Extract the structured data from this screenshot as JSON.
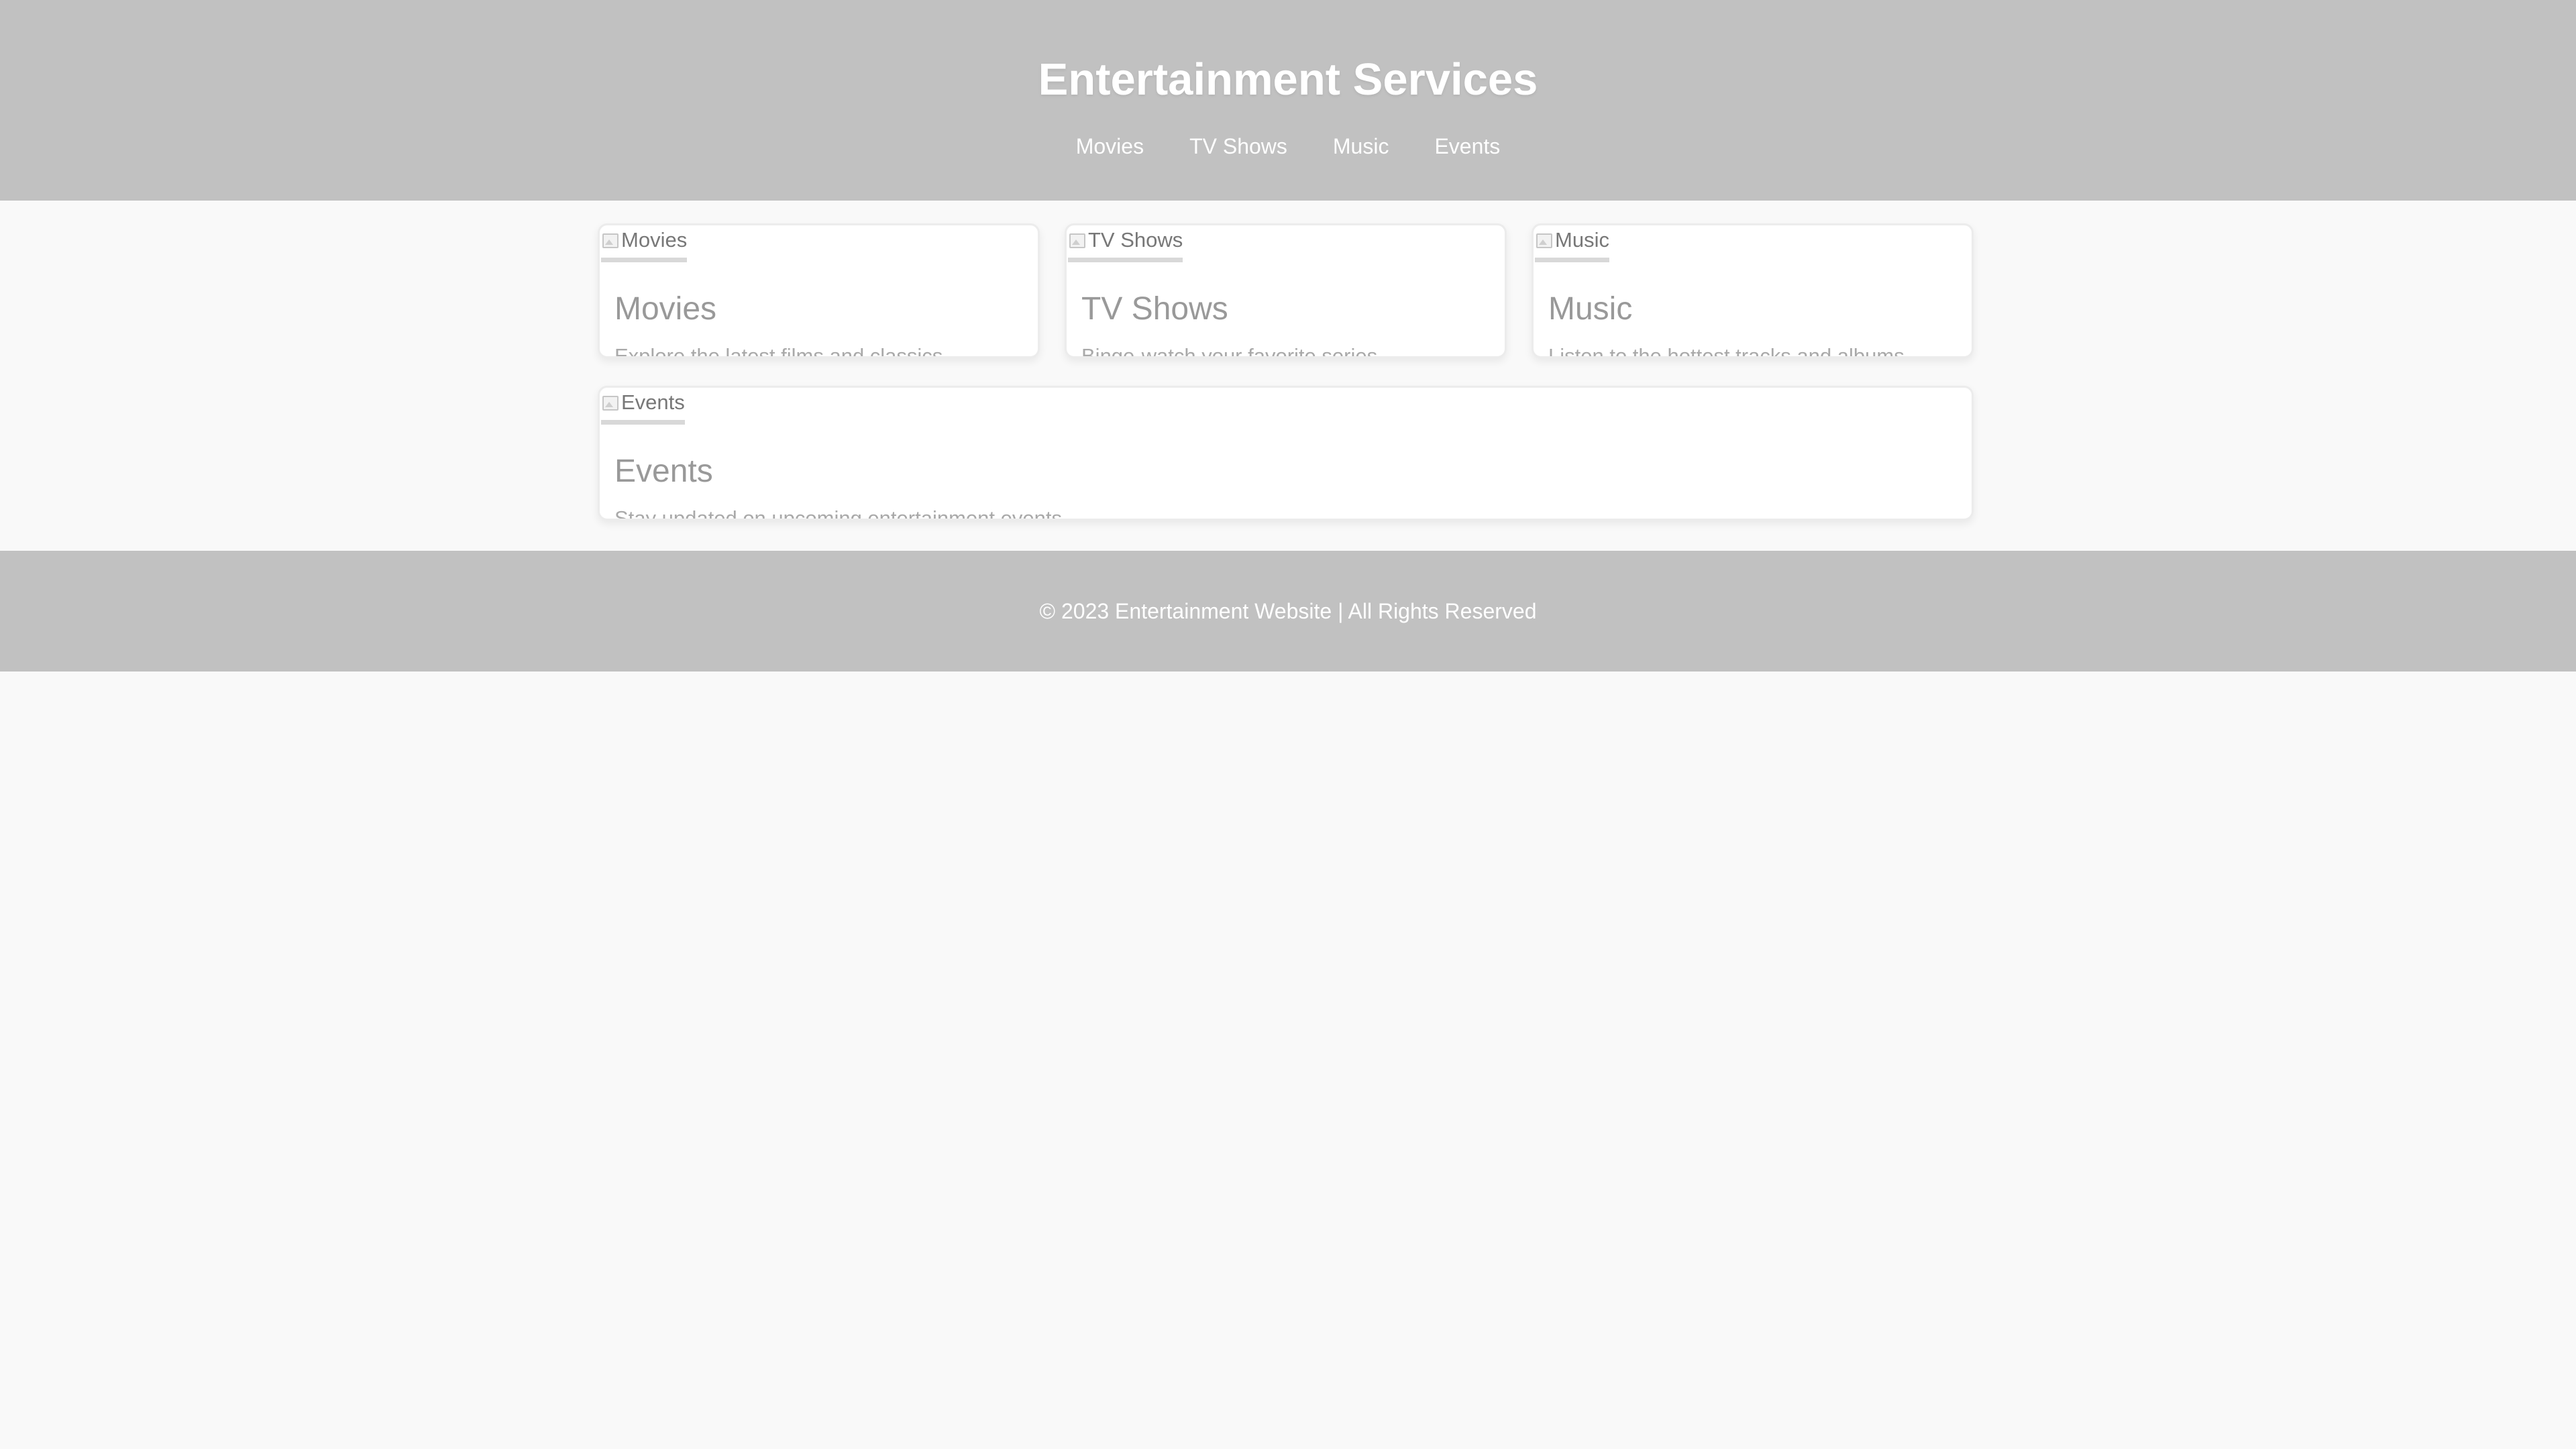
{
  "header": {
    "title": "Entertainment Services",
    "nav": [
      "Movies",
      "TV Shows",
      "Music",
      "Events"
    ]
  },
  "cards": [
    {
      "image_alt": "Movies",
      "title": "Movies",
      "description": "Explore the latest films and classics."
    },
    {
      "image_alt": "TV Shows",
      "title": "TV Shows",
      "description": "Binge-watch your favorite series."
    },
    {
      "image_alt": "Music",
      "title": "Music",
      "description": "Listen to the hottest tracks and albums."
    },
    {
      "image_alt": "Events",
      "title": "Events",
      "description": "Stay updated on upcoming entertainment events."
    }
  ],
  "footer": {
    "text": "© 2023 Entertainment Website | All Rights Reserved"
  },
  "colors": {
    "header_bg": "#c1c1c1",
    "page_bg": "#f9f9f9",
    "card_bg": "#ffffff",
    "header_text": "#ffffff"
  }
}
